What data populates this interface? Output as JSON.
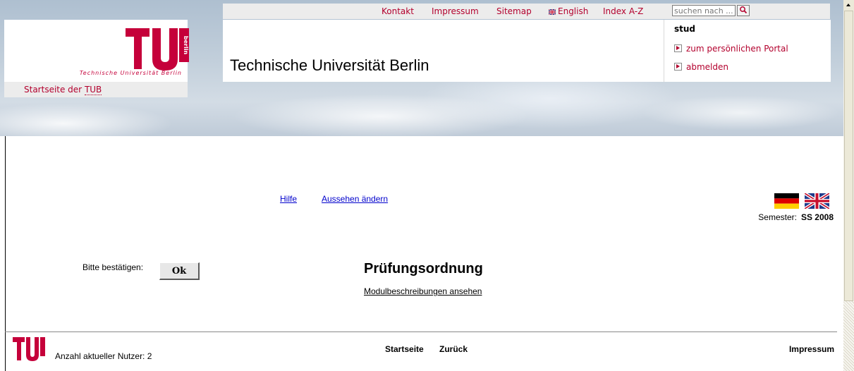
{
  "header": {
    "logo_caption": "Technische Universität Berlin",
    "logo_mark": "berlin",
    "site_title": "Technische Universität Berlin",
    "home_link_prefix": "Startseite der ",
    "home_link_abbr": "TUB",
    "top_nav": {
      "kontakt": "Kontakt",
      "impressum": "Impressum",
      "sitemap": "Sitemap",
      "english": "English",
      "index": "Index A-Z"
    },
    "search": {
      "placeholder": "suchen nach ...",
      "icon": "search-icon"
    },
    "user": {
      "name": "stud",
      "portal_link": "zum persönlichen Portal",
      "logout_link": "abmelden"
    }
  },
  "main": {
    "help_link": "Hilfe",
    "appearance_link": "Aussehen ändern",
    "semester_label": "Semester:",
    "semester_value": "SS 2008",
    "confirm_label": "Bitte bestätigen:",
    "ok_button": "Ok",
    "title": "Prüfungsordnung",
    "module_link": "Modulbeschreibungen ansehen"
  },
  "footer": {
    "users_label": "Anzahl aktueller Nutzer:",
    "users_count": "2",
    "start_link": "Startseite",
    "back_link": "Zurück",
    "impressum_link": "Impressum"
  },
  "colors": {
    "accent": "#b3002d",
    "link": "#0000cc"
  }
}
